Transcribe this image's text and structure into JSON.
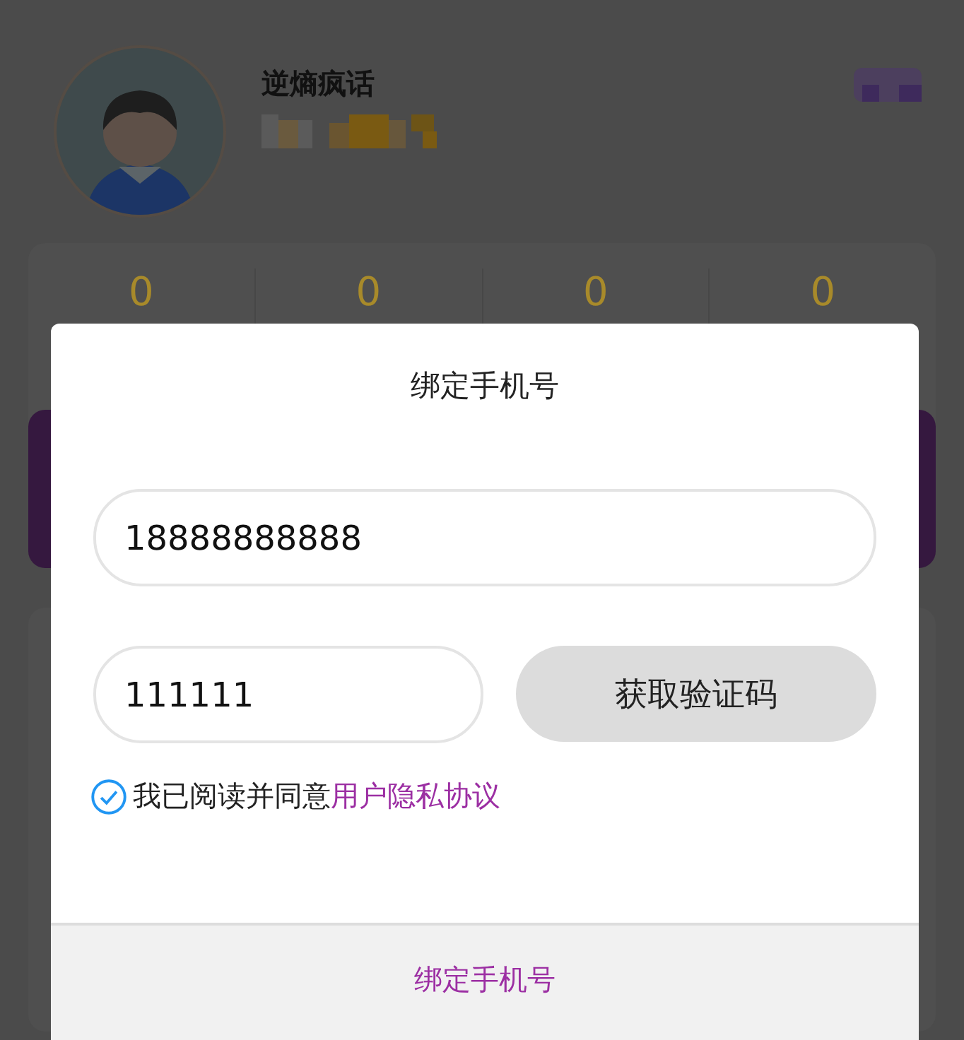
{
  "profile": {
    "name": "逆熵疯话"
  },
  "stats": [
    {
      "value": "0"
    },
    {
      "value": "0"
    },
    {
      "value": "0"
    },
    {
      "value": "0"
    }
  ],
  "dialog": {
    "title": "绑定手机号",
    "phone_field": {
      "value": "18888888888"
    },
    "code_field": {
      "value": "111111"
    },
    "code_button": "获取验证码",
    "agreement": {
      "checked": true,
      "text": "我已阅读并同意",
      "link": "用户隐私协议"
    },
    "confirm_button": "绑定手机号"
  }
}
